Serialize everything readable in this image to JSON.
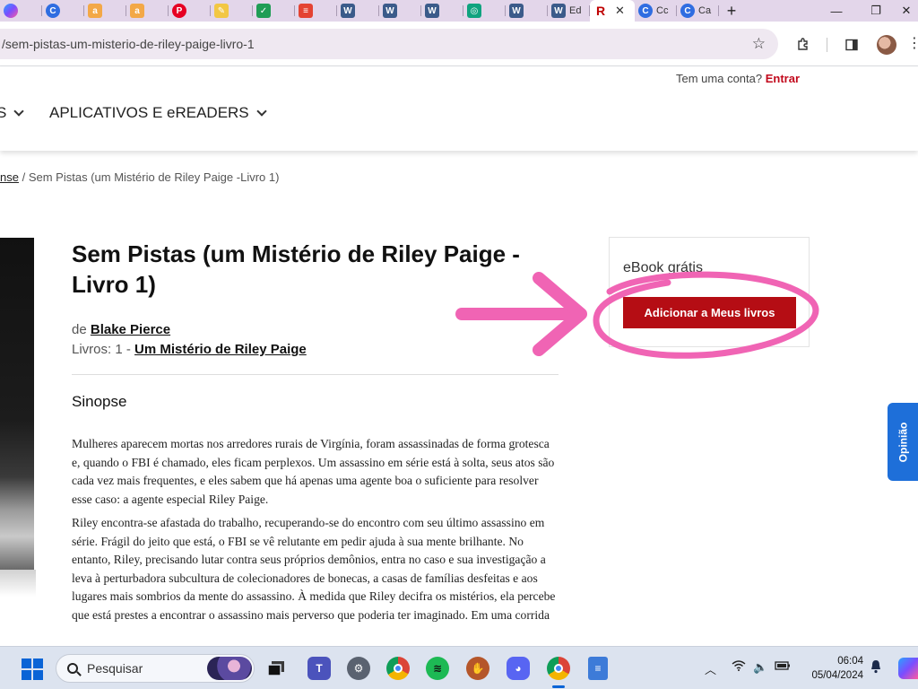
{
  "browser": {
    "tabs": [
      {
        "icon": "copilot-icon",
        "color": "#7c4dff",
        "glyph": "",
        "text": ""
      },
      {
        "icon": "c-icon",
        "color": "#2f6de1",
        "glyph": "C",
        "text": ""
      },
      {
        "icon": "amazon-icon",
        "color": "#f3a847",
        "glyph": "a",
        "text": ""
      },
      {
        "icon": "amazon-icon",
        "color": "#f3a847",
        "glyph": "a",
        "text": ""
      },
      {
        "icon": "pinterest-icon",
        "color": "#e60023",
        "glyph": "P",
        "text": ""
      },
      {
        "icon": "notes-icon",
        "color": "#f2c744",
        "glyph": "✎",
        "text": ""
      },
      {
        "icon": "sheets-icon",
        "color": "#1f9d55",
        "glyph": "✓",
        "text": ""
      },
      {
        "icon": "todoist-icon",
        "color": "#e44332",
        "glyph": "≡",
        "text": ""
      },
      {
        "icon": "wordpress-icon",
        "color": "#3b5b8a",
        "glyph": "W",
        "text": ""
      },
      {
        "icon": "wordpress-icon",
        "color": "#3b5b8a",
        "glyph": "W",
        "text": ""
      },
      {
        "icon": "wordpress-icon",
        "color": "#3b5b8a",
        "glyph": "W",
        "text": ""
      },
      {
        "icon": "chatgpt-icon",
        "color": "#10a37f",
        "glyph": "◎",
        "text": ""
      },
      {
        "icon": "wordpress-icon",
        "color": "#3b5b8a",
        "glyph": "W",
        "text": ""
      },
      {
        "icon": "wordpress-icon",
        "color": "#3b5b8a",
        "glyph": "W",
        "text": "Ed"
      }
    ],
    "active_tab": {
      "icon": "rakuten-icon",
      "color": "#bf0000",
      "glyph": "R",
      "close": "✕"
    },
    "after_tabs": [
      {
        "icon": "c-icon",
        "color": "#2f6de1",
        "glyph": "C",
        "text": "Cc"
      },
      {
        "icon": "c-icon",
        "color": "#2f6de1",
        "glyph": "C",
        "text": "Ca"
      }
    ],
    "new_tab": "+",
    "window_controls": {
      "minimize": "—",
      "restore": "❐",
      "close": "✕"
    },
    "url": "/sem-pistas-um-misterio-de-riley-paige-livro-1"
  },
  "header": {
    "account_prompt": "Tem uma conta?",
    "signin_label": "Entrar",
    "nav": [
      {
        "label": "S"
      },
      {
        "label": "APLICATIVOS E eREADERS"
      }
    ]
  },
  "breadcrumb": {
    "link": "nse",
    "separator": "/",
    "current": "Sem Pistas (um Mistério de Riley Paige -Livro 1)"
  },
  "book": {
    "title": "Sem Pistas (um Mistério de Riley Paige - Livro 1)",
    "by_label": "de",
    "author": "Blake Pierce",
    "series_prefix": "Livros: 1 -",
    "series": "Um Mistério de Riley Paige",
    "synopsis_heading": "Sinopse",
    "synopsis": [
      "Mulheres aparecem mortas nos arredores rurais de Virgínia, foram assassinadas de forma grotesca e, quando o FBI é chamado, eles ficam perplexos. Um assassino em série está à solta, seus atos são cada vez mais frequentes, e eles sabem que há apenas uma agente boa o suficiente para resolver esse caso: a agente especial Riley Paige.",
      "Riley encontra-se afastada do trabalho, recuperando-se do encontro com seu último assassino em série. Frágil do jeito que está, o FBI se vê relutante em pedir ajuda à sua mente brilhante. No entanto, Riley, precisando lutar contra seus próprios demônios, entra no caso e sua investigação a leva à perturbadora subcultura de colecionadores de bonecas, a casas de famílias desfeitas e aos lugares mais sombrios da mente do assassino. À medida que Riley decifra os mistérios, ela percebe que está prestes a encontrar o assassino mais perverso que poderia ter imaginado. Em uma corrida"
    ]
  },
  "sidebox": {
    "label": "eBook grátis",
    "button": "Adicionar a Meus livros"
  },
  "feedback": {
    "label": "Opinião"
  },
  "taskbar": {
    "search_placeholder": "Pesquisar",
    "time": "06:04",
    "date": "05/04/2024"
  },
  "colors": {
    "accent_red": "#b50d14",
    "signin_red": "#c2091c",
    "annotation_pink": "#f064b4",
    "feedback_blue": "#1e6fd9"
  }
}
